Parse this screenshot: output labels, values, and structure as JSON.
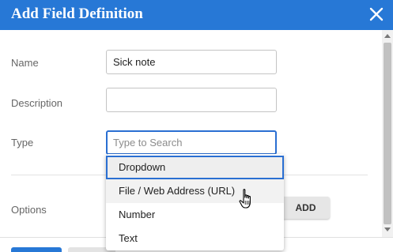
{
  "dialog": {
    "title": "Add Field Definition",
    "close_icon": "close-icon"
  },
  "form": {
    "name_label": "Name",
    "name_value": "Sick note",
    "description_label": "Description",
    "description_value": "",
    "type_label": "Type",
    "type_placeholder": "Type to Search",
    "options_label": "Options",
    "add_button": "ADD"
  },
  "type_dropdown": {
    "options": [
      {
        "label": "Dropdown",
        "state": "selected"
      },
      {
        "label": "File / Web Address (URL)",
        "state": "hover"
      },
      {
        "label": "Number",
        "state": "normal"
      },
      {
        "label": "Text",
        "state": "normal"
      }
    ]
  },
  "colors": {
    "header": "#2778d6",
    "focus_border": "#2a6fd2"
  },
  "cursor_icon": "hand-pointer-icon"
}
